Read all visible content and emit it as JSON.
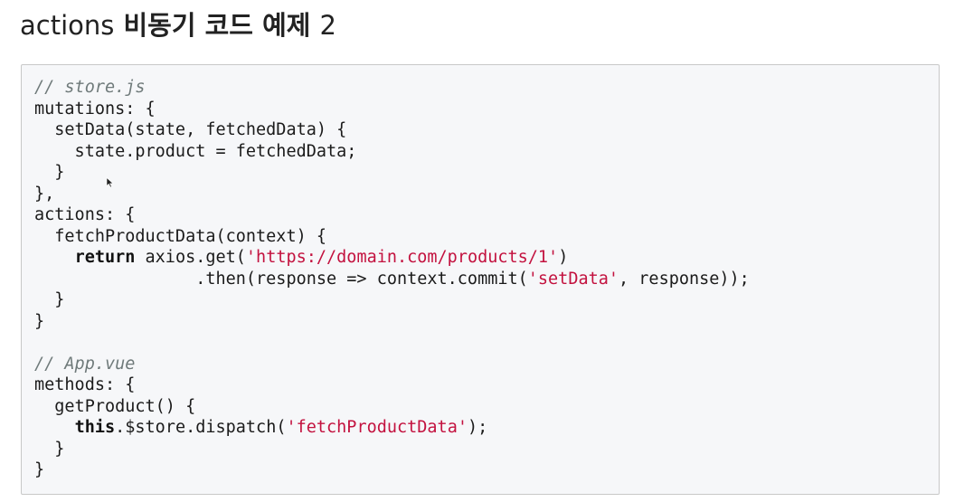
{
  "title": {
    "en": "actions",
    "ko": "비동기 코드 예제",
    "num": "2"
  },
  "code": {
    "lines": [
      [
        {
          "t": "comment",
          "v": "// store.js"
        }
      ],
      [
        {
          "t": "plain",
          "v": "mutations: {"
        }
      ],
      [
        {
          "t": "plain",
          "v": "  setData(state, fetchedData) {"
        }
      ],
      [
        {
          "t": "plain",
          "v": "    state.product = fetchedData;"
        }
      ],
      [
        {
          "t": "plain",
          "v": "  }"
        }
      ],
      [
        {
          "t": "plain",
          "v": "},"
        }
      ],
      [
        {
          "t": "plain",
          "v": "actions: {"
        }
      ],
      [
        {
          "t": "plain",
          "v": "  fetchProductData(context) {"
        }
      ],
      [
        {
          "t": "plain",
          "v": "    "
        },
        {
          "t": "keyword",
          "v": "return"
        },
        {
          "t": "plain",
          "v": " axios.get("
        },
        {
          "t": "string",
          "v": "'https://domain.com/products/1'"
        },
        {
          "t": "plain",
          "v": ")"
        }
      ],
      [
        {
          "t": "plain",
          "v": "                .then(response => context.commit("
        },
        {
          "t": "string",
          "v": "'setData'"
        },
        {
          "t": "plain",
          "v": ", response));"
        }
      ],
      [
        {
          "t": "plain",
          "v": "  }"
        }
      ],
      [
        {
          "t": "plain",
          "v": "}"
        }
      ],
      [
        {
          "t": "plain",
          "v": ""
        }
      ],
      [
        {
          "t": "comment",
          "v": "// App.vue"
        }
      ],
      [
        {
          "t": "plain",
          "v": "methods: {"
        }
      ],
      [
        {
          "t": "plain",
          "v": "  getProduct() {"
        }
      ],
      [
        {
          "t": "plain",
          "v": "    "
        },
        {
          "t": "keyword",
          "v": "this"
        },
        {
          "t": "plain",
          "v": ".$store.dispatch("
        },
        {
          "t": "string",
          "v": "'fetchProductData'"
        },
        {
          "t": "plain",
          "v": ");"
        }
      ],
      [
        {
          "t": "plain",
          "v": "  }"
        }
      ],
      [
        {
          "t": "plain",
          "v": "}"
        }
      ]
    ]
  },
  "colors": {
    "comment": "#6f7a7a",
    "string": "#c3123f",
    "code_background": "#f6f7f9"
  },
  "icons": {
    "cursor": "mouse-pointer-icon"
  }
}
